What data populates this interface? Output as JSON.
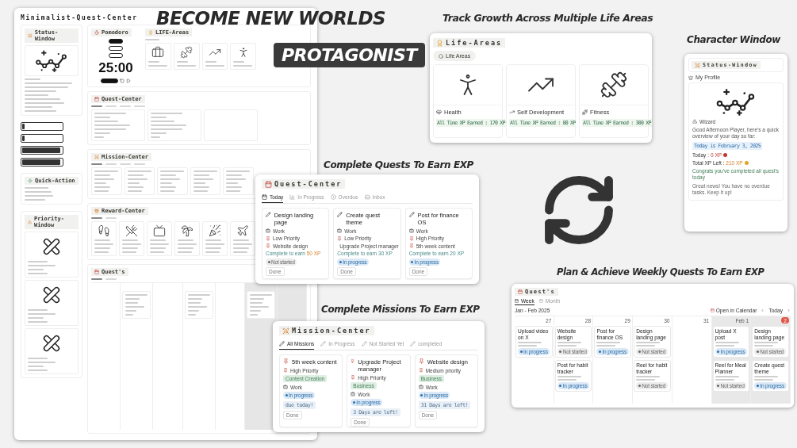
{
  "hero": {
    "line1": "BECOME NEW WORLDS",
    "line2": "PROTAGONIST"
  },
  "dashboard": {
    "title": "Minimalist-Quest-Center",
    "status_window": {
      "title": "Status-Window"
    },
    "meters": [
      {
        "level": 0.06
      },
      {
        "level": 0.06
      },
      {
        "level": 0.96
      },
      {
        "level": 0.96
      }
    ],
    "quick_action": {
      "title": "Quick-Action"
    },
    "priority_window": {
      "title": "Priority-Window"
    },
    "pomodoro": {
      "title": "Pomodoro",
      "time": "25:00"
    },
    "life_areas": {
      "title": "LIFE-Areas",
      "items": [
        {
          "kind": "work"
        },
        {
          "kind": "fitness"
        },
        {
          "kind": "growth"
        },
        {
          "kind": "health"
        }
      ]
    },
    "quest_center": {
      "title": "Quest-Center"
    },
    "mission_center": {
      "title": "Mission-Center"
    },
    "reward_center": {
      "title": "Reward-Center",
      "items": [
        {
          "kind": "walk"
        },
        {
          "kind": "dinner"
        },
        {
          "kind": "movie"
        },
        {
          "kind": "dayoff"
        },
        {
          "kind": "party"
        },
        {
          "kind": "vacation"
        }
      ]
    },
    "quests": {
      "title": "Quest's",
      "days": [
        {
          "weekend": false,
          "has_quest": false
        },
        {
          "weekend": false,
          "has_quest": true
        },
        {
          "weekend": false,
          "has_quest": false
        },
        {
          "weekend": false,
          "has_quest": true
        },
        {
          "weekend": false,
          "has_quest": false
        },
        {
          "weekend": true,
          "has_quest": true
        },
        {
          "weekend": true,
          "has_quest": false
        }
      ]
    }
  },
  "life_areas_view": {
    "caption": "Track Growth Across Multiple Life Areas",
    "title": "Life-Areas",
    "filter": "Life Areas",
    "items": [
      {
        "name": "Health",
        "kind": "health",
        "xp": "All Time XP Earned : 170 XP"
      },
      {
        "name": "Self Development",
        "kind": "growth",
        "xp": "All Time XP Earned : 80 XP"
      },
      {
        "name": "Fitness",
        "kind": "fitness",
        "xp": "All Time XP Earned : 300 XP"
      }
    ]
  },
  "character_view": {
    "caption": "Character Window",
    "title": "Status-Window",
    "profile": "My Profile",
    "name": "Wizard",
    "greeting": "Good Afternoon Player, here's a quick overview of your day so far:",
    "date": "Today is February 3, 2025",
    "today_label": "Today :",
    "today_xp": "0 XP",
    "total_label": "Total XP Left :",
    "total_xp": "210 XP",
    "congrats": "Congrats you've completed all quest's today",
    "news": "Great news! You have no overdue tasks. Keep it up!"
  },
  "quest_view": {
    "caption": "Complete Quests To Earn EXP",
    "title": "Quest-Center",
    "tabs": [
      {
        "label": "Today",
        "selected": true
      },
      {
        "label": "In Progress",
        "selected": false
      },
      {
        "label": "Overdue",
        "selected": false
      },
      {
        "label": "Inbox",
        "selected": false
      }
    ],
    "cards": [
      {
        "title": "Design landing page",
        "area": "Work",
        "priority": "Low Priority",
        "mission": "Website design",
        "earn": "Complete to earn",
        "xp": "50 XP",
        "xp_highlight": true,
        "status": {
          "label": "Not started",
          "kind": "not_started"
        },
        "done": "Done"
      },
      {
        "title": "Create quest theme",
        "area": "Work",
        "priority": "Low Priority",
        "mission": "Upgrade Project manager",
        "earn": "Complete to earn",
        "xp": "30 XP",
        "xp_highlight": false,
        "status": {
          "label": "In progress",
          "kind": "in_progress"
        },
        "done": "Done"
      },
      {
        "title": "Post for finance OS",
        "area": "Work",
        "priority": "High Priority",
        "mission": "5th week content",
        "earn": "Complete to earn",
        "xp": "20 XP",
        "xp_highlight": false,
        "status": {
          "label": "In progress",
          "kind": "in_progress"
        },
        "done": "Done"
      }
    ]
  },
  "mission_view": {
    "caption": "Complete Missions To Earn EXP",
    "title": "Mission-Center",
    "tabs": [
      {
        "label": "All Missions",
        "selected": true
      },
      {
        "label": "In Progress",
        "selected": false
      },
      {
        "label": "Not Started Yet",
        "selected": false
      },
      {
        "label": "completed",
        "selected": false
      }
    ],
    "cards": [
      {
        "title": "5th week content",
        "priority": "High Priority",
        "tag": "Content Creation",
        "area": "Work",
        "status": {
          "label": "In progress",
          "kind": "in_progress"
        },
        "deadline": "due today!",
        "done": "Done"
      },
      {
        "title": "Upgrade Project manager",
        "priority": "High Priority",
        "tag": "Business",
        "area": "Work",
        "status": {
          "label": "In progress",
          "kind": "in_progress"
        },
        "deadline": "3 Days are left!",
        "done": "Done"
      },
      {
        "title": "Website design",
        "priority": "Medium priority",
        "tag": "Business",
        "area": "Work",
        "status": {
          "label": "In progress",
          "kind": "in_progress"
        },
        "deadline": "31 Days are left!",
        "done": "Done"
      }
    ]
  },
  "calendar_view": {
    "caption": "Plan & Achieve Weekly Quests To Earn EXP",
    "title": "Quest's",
    "tabs": [
      {
        "label": "Week",
        "selected": true
      },
      {
        "label": "Month",
        "selected": false
      }
    ],
    "range": "Jan - Feb 2025",
    "open": "Open in Calendar",
    "today": "Today",
    "days": [
      {
        "date": "27",
        "weekend": false,
        "today": false,
        "cards": [
          {
            "title": "Upload video on X",
            "status": {
              "label": "In progress",
              "kind": "in_progress"
            }
          }
        ]
      },
      {
        "date": "28",
        "weekend": false,
        "today": false,
        "cards": [
          {
            "title": "Website design",
            "status": {
              "label": "Not started",
              "kind": "not_started"
            }
          },
          {
            "title": "Post for habit tracker",
            "status": {
              "label": "In progress",
              "kind": "in_progress"
            }
          }
        ]
      },
      {
        "date": "29",
        "weekend": false,
        "today": false,
        "cards": [
          {
            "title": "Post for finance OS",
            "status": {
              "label": "In progress",
              "kind": "in_progress"
            }
          }
        ]
      },
      {
        "date": "30",
        "weekend": false,
        "today": false,
        "cards": [
          {
            "title": "Design landing page",
            "status": {
              "label": "Not started",
              "kind": "not_started"
            }
          },
          {
            "title": "Reel for habit tracker",
            "status": {
              "label": "Not started",
              "kind": "not_started"
            }
          }
        ]
      },
      {
        "date": "31",
        "weekend": false,
        "today": false
      },
      {
        "date": "Feb 1",
        "weekend": true,
        "today": false,
        "cards": [
          {
            "title": "Upload X post",
            "status": {
              "label": "In progress",
              "kind": "in_progress"
            }
          },
          {
            "title": "Reel for Meal Planner",
            "status": {
              "label": "Not started",
              "kind": "not_started"
            }
          }
        ]
      },
      {
        "date": "2",
        "weekend": true,
        "today": true,
        "cards": [
          {
            "title": "Design landing page",
            "status": {
              "label": "Not started",
              "kind": "not_started"
            }
          },
          {
            "title": "Create quest theme",
            "status": {
              "label": "In progress",
              "kind": "in_progress"
            }
          }
        ]
      }
    ]
  }
}
